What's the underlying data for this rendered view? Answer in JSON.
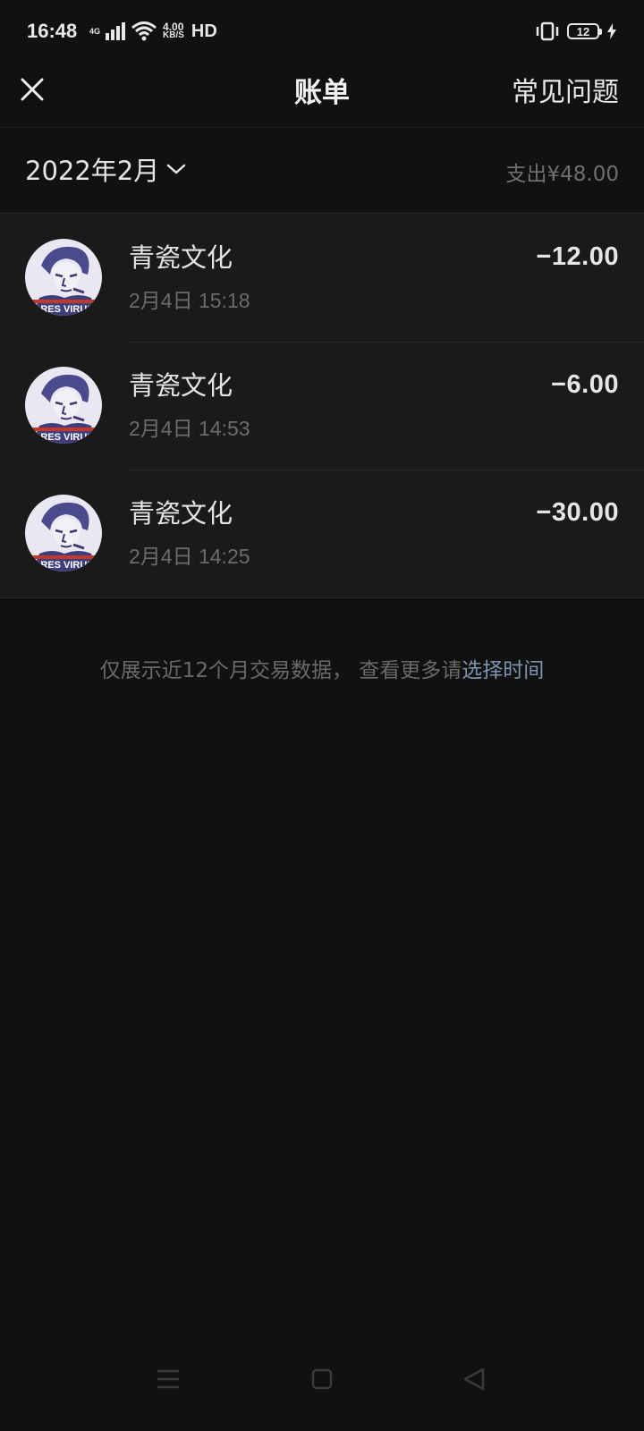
{
  "status_bar": {
    "time": "16:48",
    "network": "4G",
    "speed_value": "4.00",
    "speed_unit": "KB/S",
    "hd": "HD",
    "battery": "12"
  },
  "header": {
    "title": "账单",
    "faq_label": "常见问题",
    "close_icon": "close-icon"
  },
  "summary": {
    "month": "2022年2月",
    "expense_label": "支出",
    "expense_total": "¥48.00"
  },
  "transactions": [
    {
      "merchant": "青瓷文化",
      "time": "2月4日 15:18",
      "amount": "−12.00"
    },
    {
      "merchant": "青瓷文化",
      "time": "2月4日 14:53",
      "amount": "−6.00"
    },
    {
      "merchant": "青瓷文化",
      "time": "2月4日 14:25",
      "amount": "−30.00"
    }
  ],
  "avatar_text": "ARES VIRUS",
  "footer_note": {
    "text": "仅展示近12个月交易数据，  查看更多请",
    "link": "选择时间"
  },
  "colors": {
    "background": "#111111",
    "list_background": "#1a1a1a",
    "link": "#7d94b1",
    "avatar_accent": "#4b4a8c"
  }
}
